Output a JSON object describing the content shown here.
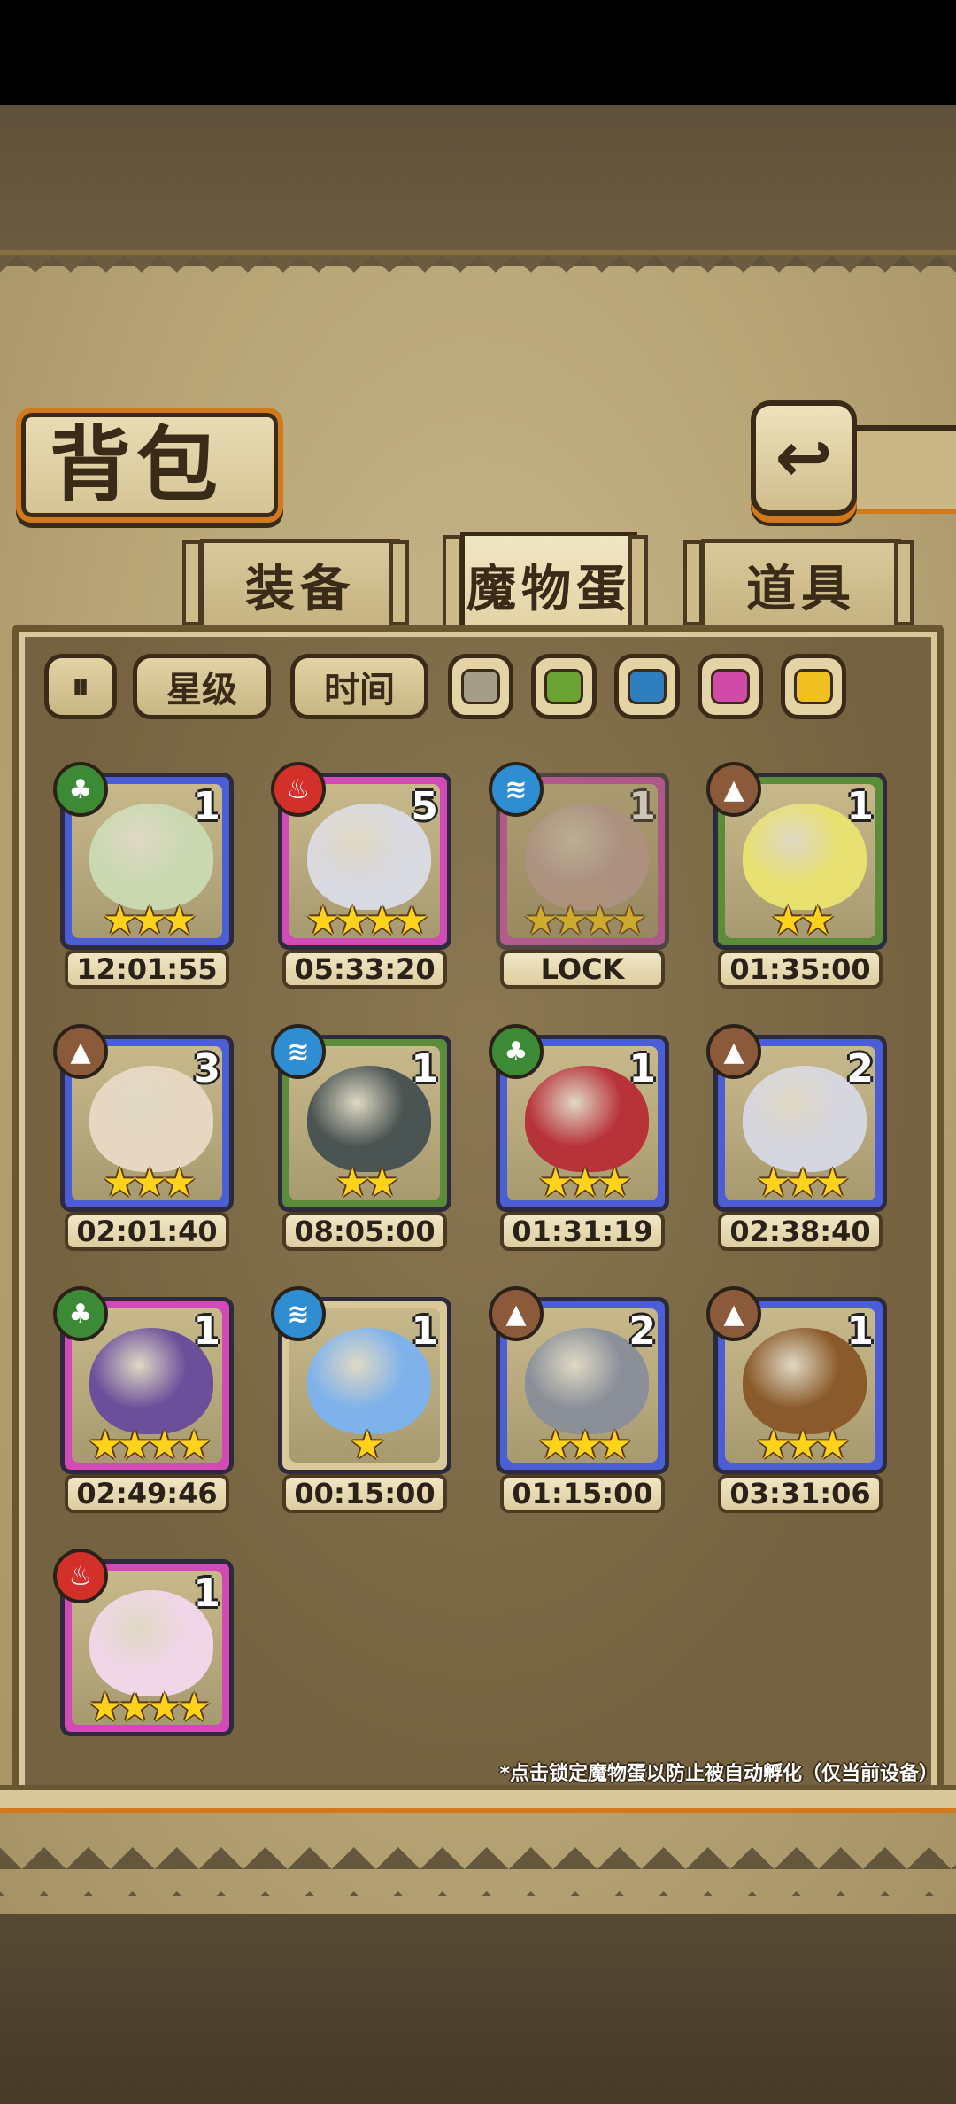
{
  "title": "背包",
  "back_icon": "return-icon",
  "tabs": [
    {
      "label": "装备",
      "active": false
    },
    {
      "label": "魔物蛋",
      "active": true
    },
    {
      "label": "道具",
      "active": false
    }
  ],
  "filters": {
    "toggle_icon": "sort-toggle-icon",
    "star_label": "星级",
    "time_label": "时间",
    "colors": [
      "#a59d8a",
      "#6aa233",
      "#2f7fbf",
      "#d04aa8",
      "#f0c020"
    ]
  },
  "eggs": [
    {
      "element": "nature",
      "frame": "blue",
      "count": "1",
      "stars": "★★★",
      "timer": "12:01:55",
      "art_color": "#c9d8b0"
    },
    {
      "element": "fire",
      "frame": "pink",
      "count": "5",
      "stars": "★★★★",
      "timer": "05:33:20",
      "art_color": "#d9d9e0"
    },
    {
      "element": "water",
      "frame": "pink",
      "count": "1",
      "stars": "★★★★",
      "timer": "LOCK",
      "art_color": "#c9a9a0"
    },
    {
      "element": "earth",
      "frame": "green",
      "count": "1",
      "stars": "★★",
      "timer": "01:35:00",
      "art_color": "#e8e070"
    },
    {
      "element": "earth",
      "frame": "blue",
      "count": "3",
      "stars": "★★★",
      "timer": "02:01:40",
      "art_color": "#e7d6c0"
    },
    {
      "element": "water",
      "frame": "green",
      "count": "1",
      "stars": "★★",
      "timer": "08:05:00",
      "art_color": "#4a5452"
    },
    {
      "element": "nature",
      "frame": "blue",
      "count": "1",
      "stars": "★★★",
      "timer": "01:31:19",
      "art_color": "#b8323a"
    },
    {
      "element": "earth",
      "frame": "blue",
      "count": "2",
      "stars": "★★★",
      "timer": "02:38:40",
      "art_color": "#d6d6de"
    },
    {
      "element": "nature",
      "frame": "pink",
      "count": "1",
      "stars": "★★★★",
      "timer": "02:49:46",
      "art_color": "#6c4f9a"
    },
    {
      "element": "water",
      "frame": "tan",
      "count": "1",
      "stars": "★",
      "timer": "00:15:00",
      "art_color": "#7fb2ea"
    },
    {
      "element": "earth",
      "frame": "blue",
      "count": "2",
      "stars": "★★★",
      "timer": "01:15:00",
      "art_color": "#8a8f98"
    },
    {
      "element": "earth",
      "frame": "blue",
      "count": "1",
      "stars": "★★★",
      "timer": "03:31:06",
      "art_color": "#8a5a2a"
    },
    {
      "element": "fire",
      "frame": "pink",
      "count": "1",
      "stars": "★★★★",
      "timer": "",
      "art_color": "#f0d6e6"
    }
  ],
  "footer_note": "*点击锁定魔物蛋以防止被自动孵化（仅当前设备）"
}
